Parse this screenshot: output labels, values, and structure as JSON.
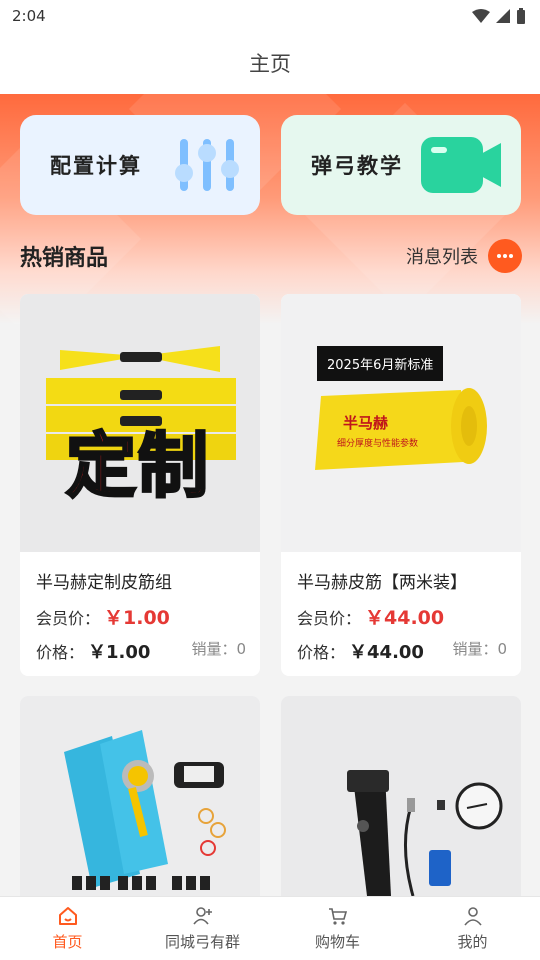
{
  "status": {
    "time": "2:04"
  },
  "header": {
    "title": "主页"
  },
  "features": [
    {
      "label": "配置计算",
      "icon": "sliders-icon",
      "color": "#4aa3ff"
    },
    {
      "label": "弹弓教学",
      "icon": "video-camera-icon",
      "color": "#2dd4a0"
    }
  ],
  "hot": {
    "title": "热销商品",
    "messages_label": "消息列表"
  },
  "products": [
    {
      "name": "半马赫定制皮筋组",
      "member_label": "会员价：",
      "member_price": "￥1.00",
      "price_label": "价格：",
      "price": "￥1.00",
      "sales": "销量：0",
      "overlay_text": "定制"
    },
    {
      "name": "半马赫皮筋【两米装】",
      "member_label": "会员价：",
      "member_price": "￥44.00",
      "price_label": "价格：",
      "price": "￥44.00",
      "sales": "销量：0",
      "banner_text": "2025年6月新标准",
      "roll_title": "半马赫",
      "roll_sub": "细分厚度与性能参数"
    },
    {
      "name": "",
      "image": "slingshot-tool-kit"
    },
    {
      "name": "",
      "image": "flashlight-kit"
    }
  ],
  "tabs": [
    {
      "label": "首页",
      "icon": "home-icon",
      "active": true
    },
    {
      "label": "同城弓有群",
      "icon": "group-add-icon"
    },
    {
      "label": "购物车",
      "icon": "cart-icon"
    },
    {
      "label": "我的",
      "icon": "user-icon"
    }
  ],
  "colors": {
    "accent": "#ff5a1f",
    "price_red": "#e53935"
  }
}
